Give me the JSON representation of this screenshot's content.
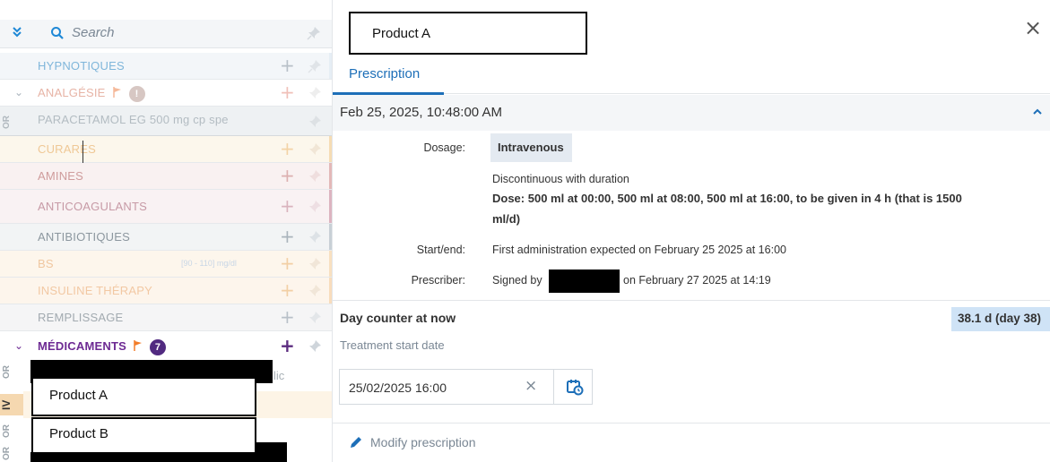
{
  "sidebar": {
    "search_placeholder": "Search",
    "groups": {
      "hypnotiques": "HYPNOTIQUES",
      "analgesie": "ANALGÉSIE",
      "analgesie_badge": "!",
      "paracetamol": "PARACETAMOL EG 500 mg cp spe",
      "paracetamol_tab": "OR",
      "curares": "CURARES",
      "amines": "AMINES",
      "anticoagulants": "ANTICOAGULANTS",
      "antibiotiques": "ANTIBIOTIQUES",
      "bs": "BS",
      "bs_range": "[90 - 110] mg/dl",
      "insuline": "INSULINE THÉRAPY",
      "remplissage": "REMPLISSAGE",
      "medicaments": "MÉDICAMENTS",
      "medicaments_badge": "7"
    },
    "med_items": {
      "tab_or1": "OR",
      "partial_text": "lic",
      "tab_iv": "IV",
      "product_a": "Product A",
      "tab_or2": "OR",
      "product_b": "Product B",
      "tab_or3": "OR"
    }
  },
  "detail": {
    "title": "Product A",
    "tab_prescription": "Prescription",
    "timestamp": "Feb 25, 2025, 10:48:00 AM",
    "dosage_label": "Dosage:",
    "dosage_route": "Intravenous",
    "dosage_mode": "Discontinuous with duration",
    "dose_line1": "Dose: 500 ml at 00:00, 500 ml at 08:00, 500 ml at 16:00, to be given in 4 h (that is 1500",
    "dose_line2": "ml/d)",
    "start_end_label": "Start/end:",
    "start_end_value": "First administration expected on February 25 2025 at 16:00",
    "prescriber_label": "Prescriber:",
    "prescriber_signed": "Signed by",
    "prescriber_date": "on February 27 2025 at 14:19",
    "day_counter_label": "Day counter at now",
    "day_counter_value": "38.1 d (day 38)",
    "treatment_start_label": "Treatment start date",
    "treatment_start_value": "25/02/2025 16:00",
    "modify_label": "Modify prescription"
  },
  "colors": {
    "accent": "#1d6fb8",
    "medicaments": "#6d2a93",
    "flag": "#f27d2a"
  }
}
